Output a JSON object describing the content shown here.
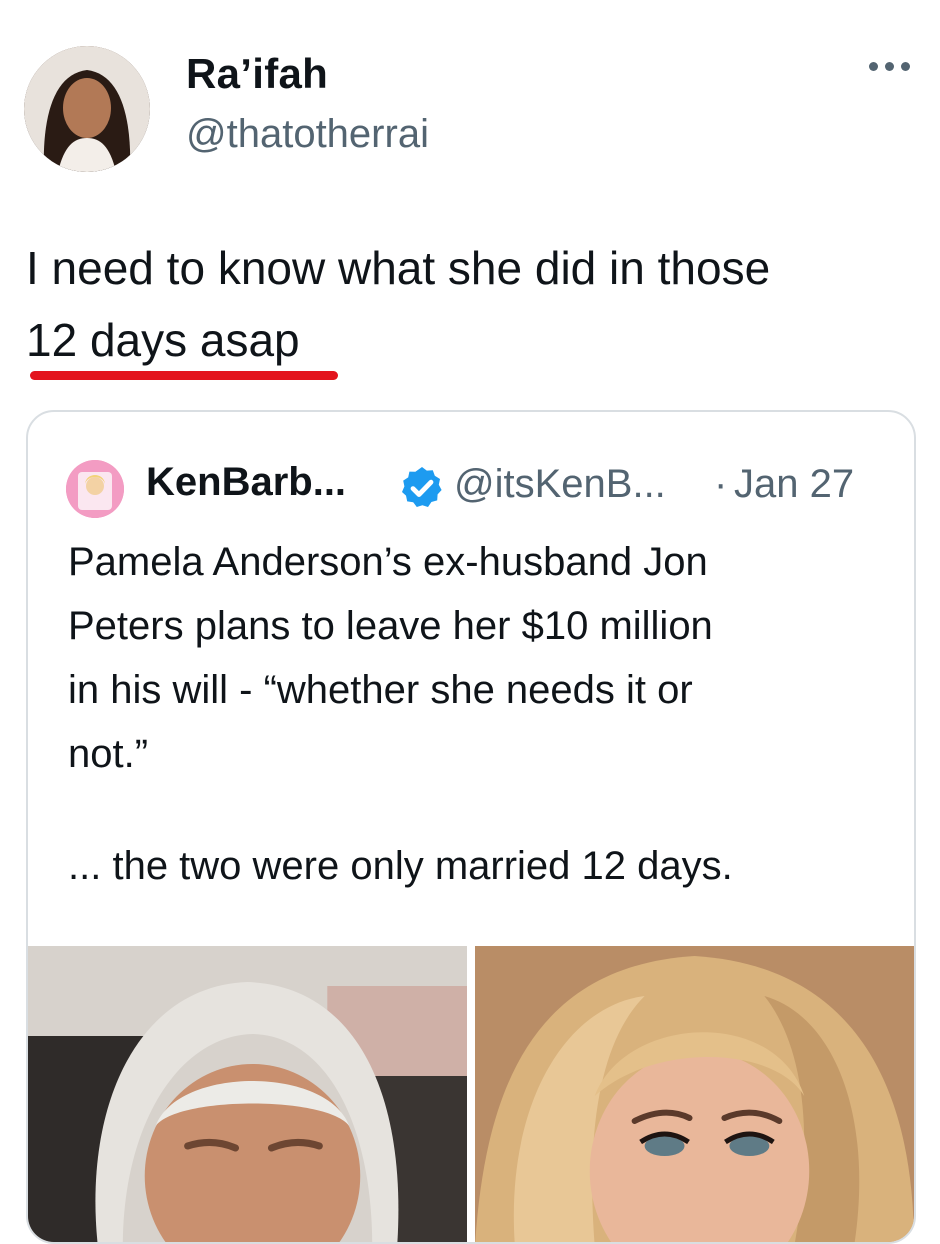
{
  "tweet": {
    "author_name": "Ra’ifah",
    "author_handle": "@thatotherrai",
    "text_line1": "I need to know what she did in those",
    "text_line2": "12 days asap",
    "highlight_color": "#e3141d"
  },
  "quoted_tweet": {
    "author_name": "KenBarb...",
    "verified": true,
    "author_handle": "@itsKenB...",
    "separator": "·",
    "date": "Jan 27",
    "body_lines": [
      "Pamela Anderson’s ex-husband Jon",
      "Peters plans to leave her $10 million",
      "in his will - “whether she needs it or",
      "not.”"
    ],
    "followup": "... the two were only married 12 days.",
    "media": [
      {
        "icon": "photo-man-grey-hair"
      },
      {
        "icon": "photo-woman-blonde-hair"
      }
    ]
  },
  "colors": {
    "text": "#0f1419",
    "secondary": "#536471",
    "verified": "#1d9bf0",
    "border": "#d9dee2"
  }
}
